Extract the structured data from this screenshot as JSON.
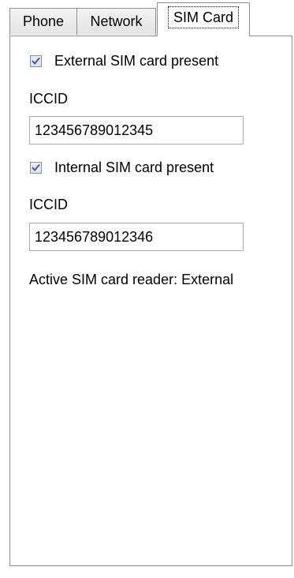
{
  "tabs": {
    "phone": "Phone",
    "network": "Network",
    "sim_card": "SIM Card",
    "selected": "SIM Card"
  },
  "external_sim": {
    "label": "External SIM card present",
    "checked": true,
    "iccid_label": "ICCID",
    "iccid_value": "123456789012345"
  },
  "internal_sim": {
    "label": "Internal SIM card present",
    "checked": true,
    "iccid_label": "ICCID",
    "iccid_value": "123456789012346"
  },
  "active_reader_text": "Active SIM card reader: External",
  "colors": {
    "border": "#8e8f8f",
    "check_mark": "#4a5f97"
  }
}
